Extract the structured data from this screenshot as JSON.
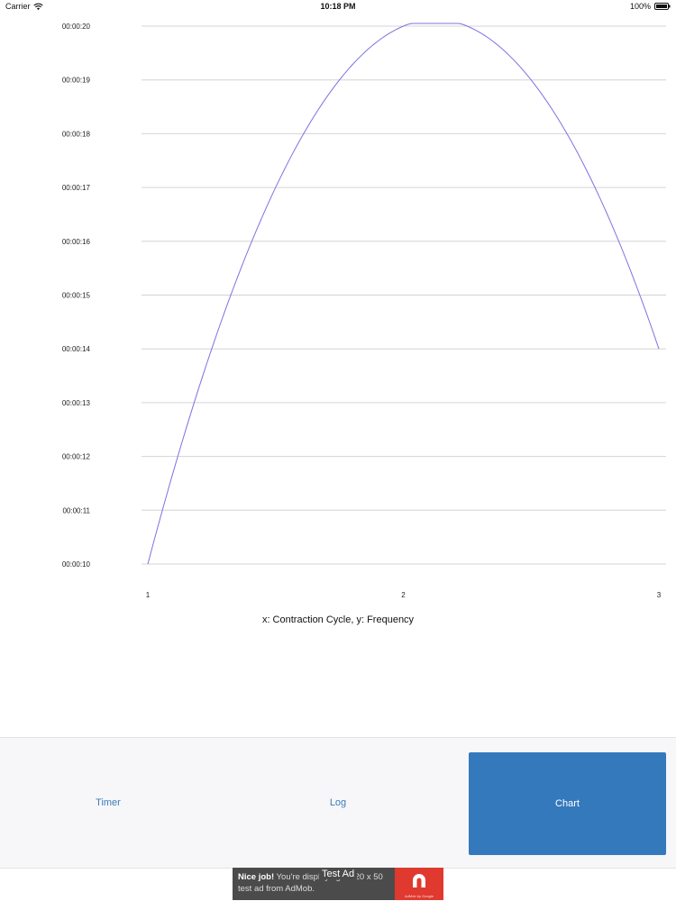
{
  "status_bar": {
    "carrier": "Carrier",
    "time": "10:18 PM",
    "battery": "100%"
  },
  "chart_data": {
    "type": "line",
    "title": "",
    "xlabel": "",
    "ylabel": "",
    "caption": "x: Contraction Cycle, y: Frequency",
    "x_ticks": [
      "1",
      "2",
      "3"
    ],
    "y_ticks": [
      "00:00:10",
      "00:00:11",
      "00:00:12",
      "00:00:13",
      "00:00:14",
      "00:00:15",
      "00:00:16",
      "00:00:17",
      "00:00:18",
      "00:00:19",
      "00:00:20"
    ],
    "xlim": [
      1,
      3
    ],
    "ylim": [
      10,
      20
    ],
    "grid": true,
    "line_color": "#7b73e0",
    "series": [
      {
        "x": [
          1,
          2,
          3
        ],
        "values": [
          10,
          20,
          14
        ]
      }
    ]
  },
  "tabs": {
    "timer": "Timer",
    "log": "Log",
    "chart": "Chart",
    "active": "chart",
    "active_color": "#3579bd"
  },
  "ad": {
    "headline": "Nice job!",
    "body": " You're displaying a 320 x 50 test ad from AdMob.",
    "test_label": "Test Ad",
    "logo_caption": "AdMob by Google"
  }
}
